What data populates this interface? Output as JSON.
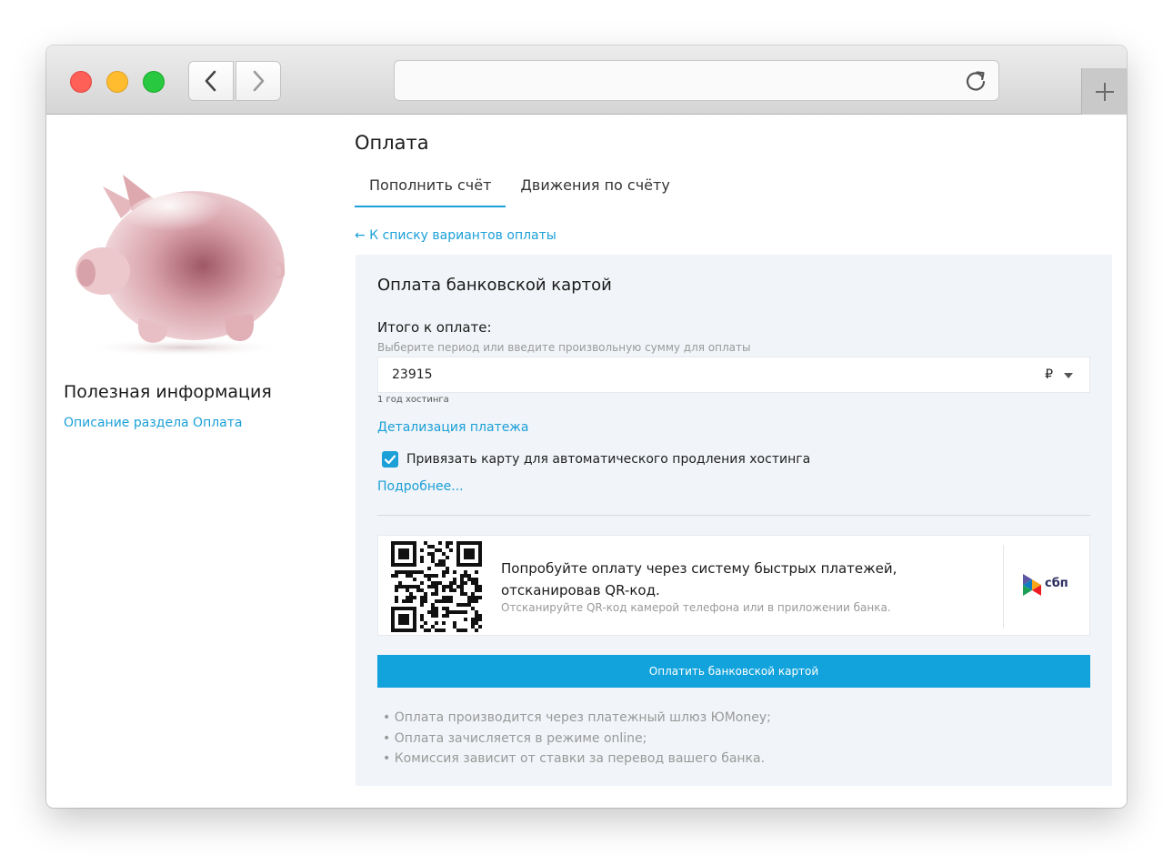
{
  "browser": {
    "icons": {
      "back": "chevron-left-icon",
      "forward": "chevron-right-icon",
      "reload": "reload-icon",
      "new_tab": "plus-icon"
    }
  },
  "sidebar": {
    "title": "Полезная информация",
    "link": "Описание раздела Оплата"
  },
  "main": {
    "title": "Оплата",
    "tabs": [
      {
        "label": "Пополнить счёт",
        "active": true
      },
      {
        "label": "Движения по счёту",
        "active": false
      }
    ],
    "back_link": "← К списку вариантов оплаты",
    "panel": {
      "title": "Оплата банковской картой",
      "total_label": "Итого к оплате:",
      "total_hint": "Выберите период или введите произвольную сумму для оплаты",
      "amount": "23915",
      "currency": "₽",
      "period": "1 год хостинга",
      "details_link": "Детализация платежа",
      "autopay_checked": true,
      "autopay_label": "Привязать карту для автоматического продления хостинга",
      "more_link": "Подробнее...",
      "sbp": {
        "text": "Попробуйте оплату через систему быстрых платежей, отсканировав QR-код.",
        "hint": "Отсканируйте QR-код камерой телефона или в приложении банка.",
        "logo_text": "сбп"
      },
      "pay_button": "Оплатить банковской картой",
      "notes": [
        "Оплата производится через платежный шлюз ЮMoney;",
        "Оплата зачисляется в режиме online;",
        "Комиссия зависит от ставки за перевод вашего банка."
      ]
    }
  },
  "colors": {
    "accent": "#1ba0d8",
    "button": "#12a3dc",
    "panel_bg": "#f1f4f8"
  }
}
